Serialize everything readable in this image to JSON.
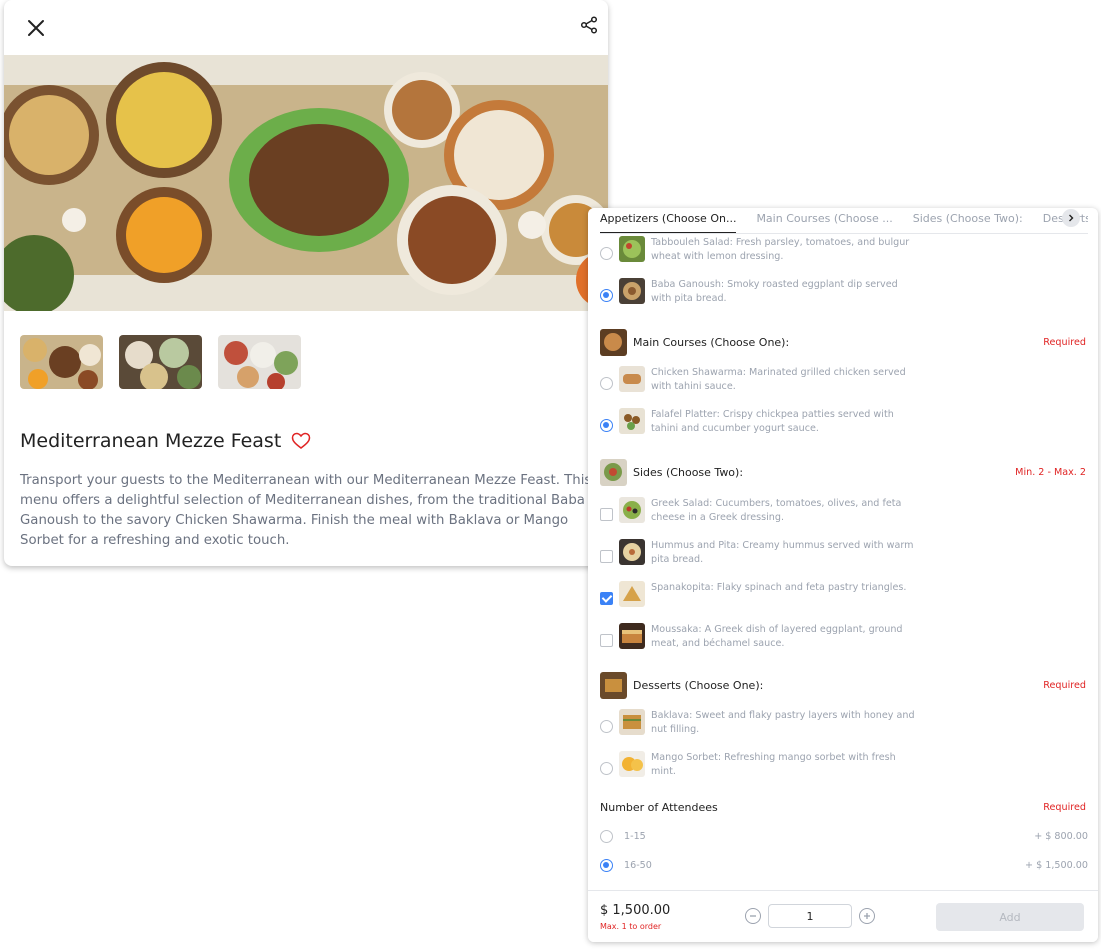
{
  "product": {
    "title": "Mediterranean Mezze Feast",
    "description": "Transport your guests to the Mediterranean with our Mediterranean Mezze Feast. This menu offers a delightful selection of Mediterranean dishes, from the traditional Baba Ganoush to the savory Chicken Shawarma. Finish the meal with Baklava or Mango Sorbet for a refreshing and exotic touch."
  },
  "tabs": [
    "Appetizers (Choose On...",
    "Main Courses (Choose ...",
    "Sides (Choose Two):",
    "Desserts (Choose One):"
  ],
  "appetizers": [
    {
      "text": "Tabbouleh Salad: Fresh parsley, tomatoes, and bulgur wheat with lemon dressing.",
      "checked": false
    },
    {
      "text": "Baba Ganoush: Smoky roasted eggplant dip served with pita bread.",
      "checked": true
    }
  ],
  "main_courses": {
    "title": "Main Courses (Choose One):",
    "requirement": "Required",
    "options": [
      {
        "text": "Chicken Shawarma: Marinated grilled chicken served with tahini sauce.",
        "checked": false
      },
      {
        "text": "Falafel Platter: Crispy chickpea patties served with tahini and cucumber yogurt sauce.",
        "checked": true
      }
    ]
  },
  "sides": {
    "title": "Sides (Choose Two):",
    "requirement": "Min. 2 - Max. 2",
    "options": [
      {
        "text": "Greek Salad: Cucumbers, tomatoes, olives, and feta cheese in a Greek dressing.",
        "checked": false
      },
      {
        "text": "Hummus and Pita: Creamy hummus served with warm pita bread.",
        "checked": false
      },
      {
        "text": "Spanakopita: Flaky spinach and feta pastry triangles.",
        "checked": true
      },
      {
        "text": "Moussaka: A Greek dish of layered eggplant, ground meat, and béchamel sauce.",
        "checked": false
      }
    ]
  },
  "desserts": {
    "title": "Desserts (Choose One):",
    "requirement": "Required",
    "options": [
      {
        "text": "Baklava: Sweet and flaky pastry layers with honey and nut filling.",
        "checked": false
      },
      {
        "text": "Mango Sorbet: Refreshing mango sorbet with fresh mint.",
        "checked": false
      }
    ]
  },
  "attendees": {
    "title": "Number of Attendees",
    "requirement": "Required",
    "options": [
      {
        "label": "1-15",
        "price": "+ $ 800.00",
        "checked": false
      },
      {
        "label": "16-50",
        "price": "+ $ 1,500.00",
        "checked": true
      }
    ]
  },
  "footer": {
    "price": "$ 1,500.00",
    "max_note": "Max. 1 to order",
    "quantity": "1",
    "add_label": "Add"
  },
  "colors": {
    "accent": "#3b82f6",
    "required": "#e02424",
    "muted_text": "#9ca3af"
  }
}
